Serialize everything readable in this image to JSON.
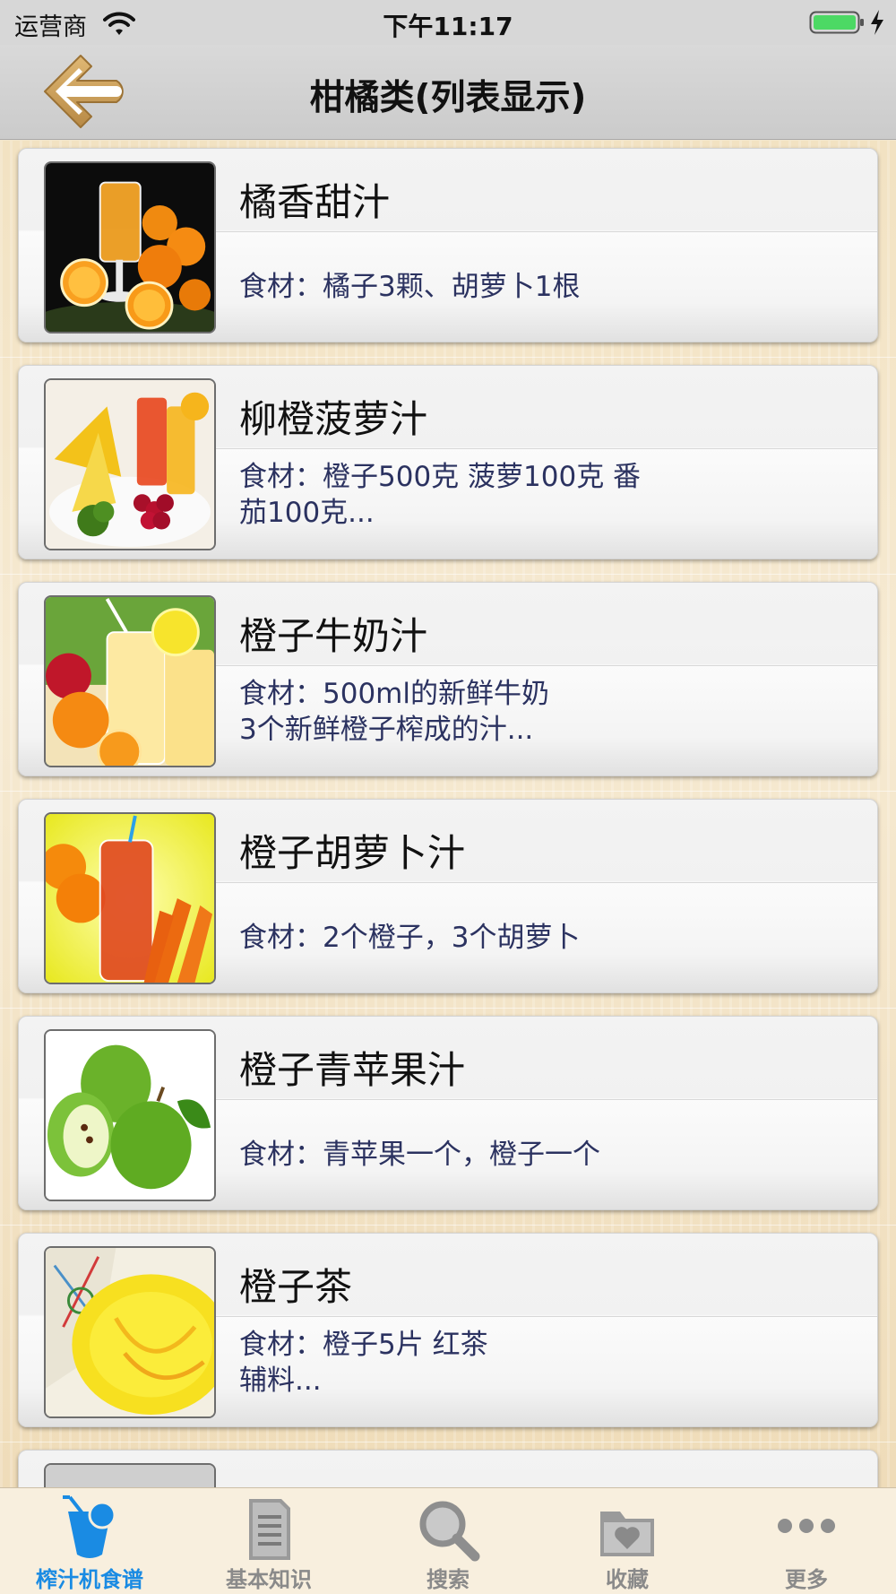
{
  "status_bar": {
    "carrier": "运营商",
    "time": "下午11:17"
  },
  "nav": {
    "title": "柑橘类(列表显示)",
    "back_icon": "back-arrow-icon"
  },
  "list": {
    "items": [
      {
        "title": "橘香甜汁",
        "desc_line1": "食材：橘子3颗、胡萝卜1根",
        "desc_line2": ""
      },
      {
        "title": "柳橙菠萝汁",
        "desc_line1": "食材：橙子500克 菠萝100克 番",
        "desc_line2": "茄100克..."
      },
      {
        "title": "橙子牛奶汁",
        "desc_line1": "食材：500ml的新鲜牛奶",
        "desc_line2": "3个新鲜橙子榨成的汁..."
      },
      {
        "title": "橙子胡萝卜汁",
        "desc_line1": "食材：2个橙子，3个胡萝卜",
        "desc_line2": ""
      },
      {
        "title": "橙子青苹果汁",
        "desc_line1": "食材：青苹果一个，橙子一个",
        "desc_line2": ""
      },
      {
        "title": "橙子茶",
        "desc_line1": "食材：橙子5片 红茶",
        "desc_line2": "辅料..."
      }
    ]
  },
  "tabs": [
    {
      "label": "榨汁机食谱",
      "icon": "juice-cup-icon",
      "active": true
    },
    {
      "label": "基本知识",
      "icon": "document-icon",
      "active": false
    },
    {
      "label": "搜索",
      "icon": "magnifier-icon",
      "active": false
    },
    {
      "label": "收藏",
      "icon": "heart-folder-icon",
      "active": false
    },
    {
      "label": "更多",
      "icon": "more-dots-icon",
      "active": false
    }
  ],
  "colors": {
    "accent": "#1a8be3",
    "tab_inactive": "#8a8a8a",
    "desc_text": "#2b3260",
    "battery": "#4cd964"
  }
}
